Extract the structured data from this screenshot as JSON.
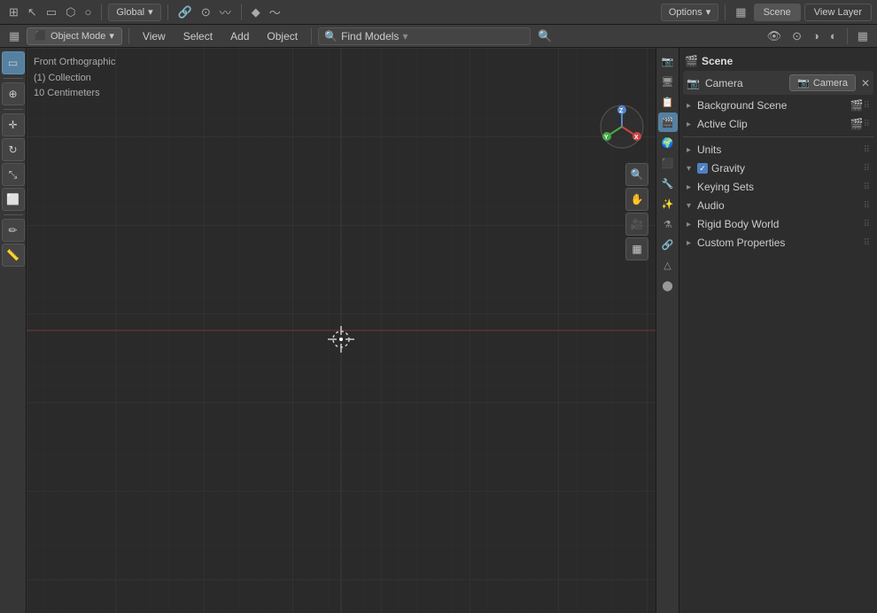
{
  "topbar": {
    "workspace_icon": "⌘",
    "transform_icon": "↖",
    "select_icon": "▭",
    "options_label": "Options",
    "global_label": "Global",
    "scene_label": "Scene",
    "view_layer_label": "View Layer",
    "editor_type_icon": "▦",
    "close_icon": "✕"
  },
  "secondbar": {
    "mode_label": "Object Mode",
    "menu_items": [
      "View",
      "Select",
      "Add",
      "Object"
    ],
    "find_models_label": "Find Models",
    "view_icon": "👁",
    "overlay_icon": "⊙"
  },
  "viewport": {
    "info_line1": "Front Orthographic",
    "info_line2": "(1) Collection",
    "info_line3": "10 Centimeters"
  },
  "left_toolbar": {
    "tools": [
      {
        "name": "select-box",
        "icon": "▭",
        "active": true
      },
      {
        "name": "cursor",
        "icon": "⊕",
        "active": false
      },
      {
        "name": "move",
        "icon": "✛",
        "active": false
      },
      {
        "name": "rotate",
        "icon": "↻",
        "active": false
      },
      {
        "name": "scale",
        "icon": "⤡",
        "active": false
      },
      {
        "name": "transform",
        "icon": "⬛",
        "active": false
      },
      {
        "name": "annotate",
        "icon": "✏",
        "active": false
      },
      {
        "name": "measure",
        "icon": "📏",
        "active": false
      }
    ]
  },
  "properties": {
    "title": "Scene",
    "camera_label": "Camera",
    "camera_value": "Camera",
    "background_scene_label": "Background Scene",
    "background_scene_icon": "🎬",
    "active_clip_label": "Active Clip",
    "active_clip_icon": "🎬",
    "sections": [
      {
        "label": "Units",
        "collapsed": true
      },
      {
        "label": "Gravity",
        "collapsed": false,
        "checked": true
      },
      {
        "label": "Keying Sets",
        "collapsed": true
      },
      {
        "label": "Audio",
        "collapsed": false
      },
      {
        "label": "Rigid Body World",
        "collapsed": true
      },
      {
        "label": "Custom Properties",
        "collapsed": true
      }
    ]
  },
  "nav_gizmo": {
    "x_label": "X",
    "y_label": "Y",
    "z_label": "Z"
  },
  "colors": {
    "accent": "#5680a0",
    "background": "#2a2a2a",
    "panel": "#2d2d2d",
    "toolbar": "#363636"
  }
}
